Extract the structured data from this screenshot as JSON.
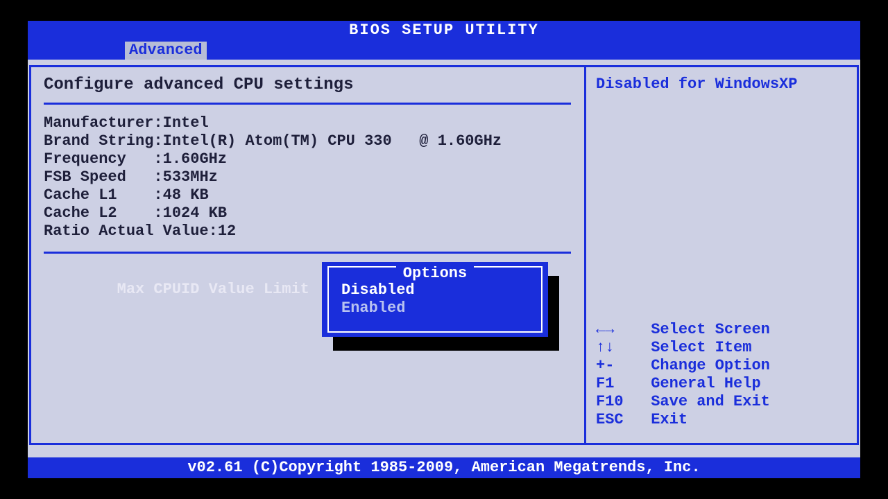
{
  "title": "BIOS SETUP UTILITY",
  "active_tab": "Advanced",
  "section_title": "Configure advanced CPU settings",
  "info": {
    "manufacturer_label": "Manufacturer:",
    "manufacturer": "Intel",
    "brand_label": "Brand String:",
    "brand": "Intel(R) Atom(TM) CPU 330   @ 1.60GHz",
    "freq_label": "Frequency   :",
    "freq": "1.60GHz",
    "fsb_label": "FSB Speed   :",
    "fsb": "533MHz",
    "l1_label": "Cache L1    :",
    "l1": "48 KB",
    "l2_label": "Cache L2    :",
    "l2": "1024 KB",
    "ratio_label": "Ratio Actual Value:",
    "ratio": "12"
  },
  "setting": {
    "name": "Max CPUID Value Limit"
  },
  "popup": {
    "title": "Options",
    "items": [
      "Disabled",
      "Enabled"
    ],
    "selected": "Disabled"
  },
  "side_help": "Disabled for WindowsXP",
  "nav": [
    {
      "key": "←→",
      "desc": "Select Screen"
    },
    {
      "key": "↑↓",
      "desc": "Select Item"
    },
    {
      "key": "+-",
      "desc": "Change Option"
    },
    {
      "key": "F1",
      "desc": "General Help"
    },
    {
      "key": "F10",
      "desc": "Save and Exit"
    },
    {
      "key": "ESC",
      "desc": "Exit"
    }
  ],
  "footer": "v02.61 (C)Copyright 1985-2009, American Megatrends, Inc."
}
